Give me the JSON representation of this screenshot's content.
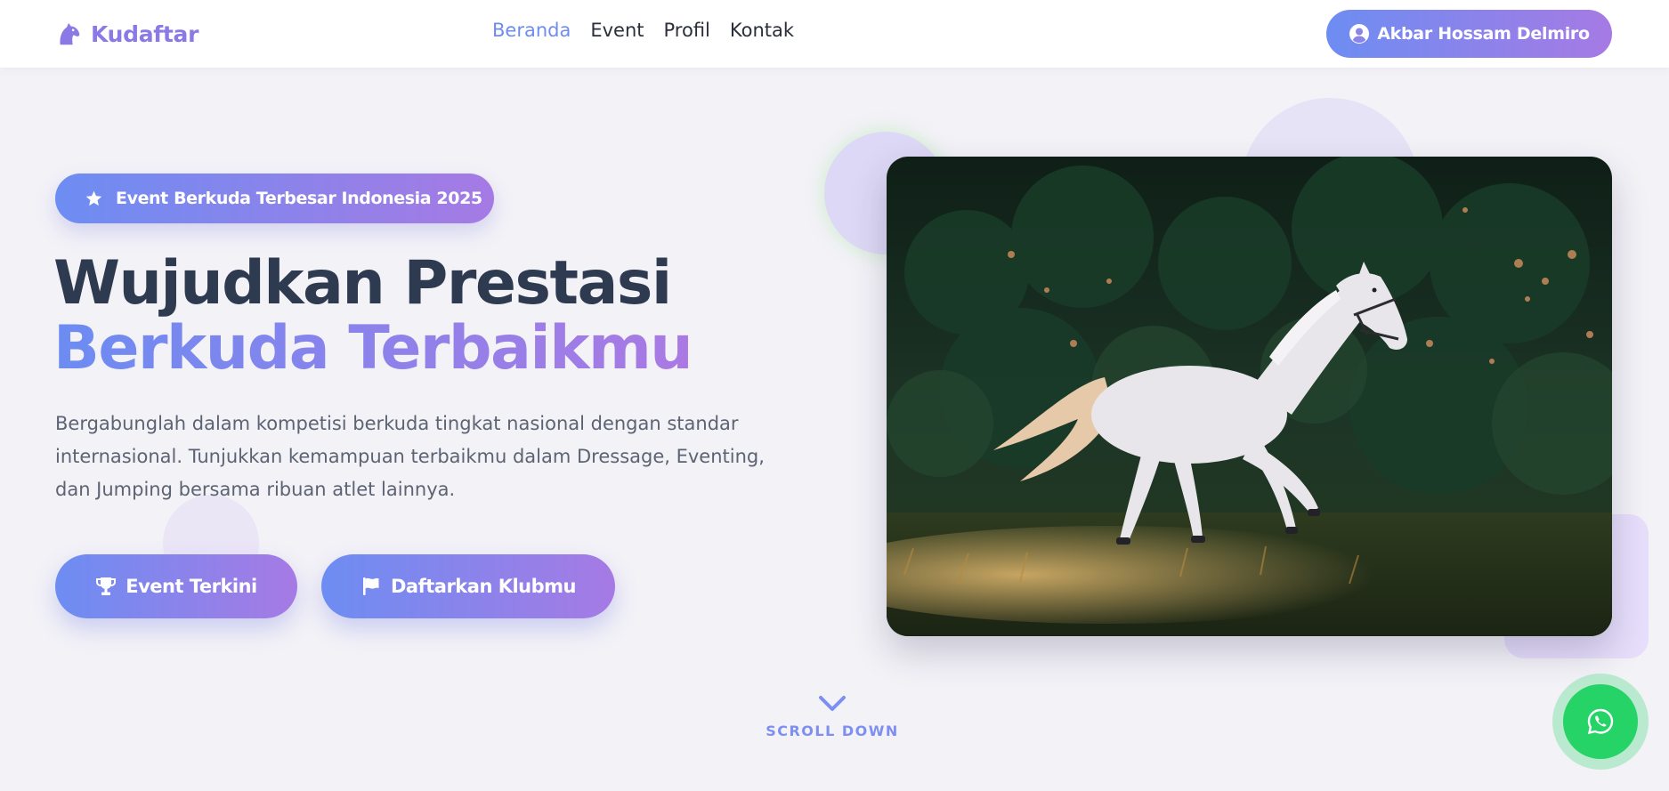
{
  "nav": {
    "brand": "Kudaftar",
    "links": [
      {
        "label": "Beranda",
        "active": true
      },
      {
        "label": "Event",
        "active": false
      },
      {
        "label": "Profil",
        "active": false
      },
      {
        "label": "Kontak",
        "active": false
      }
    ],
    "user_name": "Akbar Hossam Delmiro"
  },
  "hero": {
    "badge": "Event Berkuda Terbesar Indonesia 2025",
    "headline_line1": "Wujudkan Prestasi",
    "headline_line2": "Berkuda Terbaikmu",
    "description": "Bergabunglah dalam kompetisi berkuda tingkat nasional dengan standar internasional. Tunjukkan kemampuan terbaikmu dalam Dressage, Eventing, dan Jumping bersama ribuan atlet lainnya.",
    "primary_button": "Event Terkini",
    "secondary_button": "Daftarkan Klubmu",
    "scroll_label": "SCROLL DOWN"
  },
  "icons": {
    "brand": "horse-head-icon",
    "user": "user-circle-icon",
    "badge": "star-icon",
    "primary_button": "trophy-icon",
    "secondary_button": "flag-icon",
    "scroll": "chevron-down-icon",
    "floating": "whatsapp-icon"
  },
  "colors": {
    "accent_start": "#6d8df2",
    "accent_end": "#a67ae4",
    "active_link": "#6f8cf0",
    "heading": "#2d3a4f",
    "whatsapp": "#25d366",
    "background": "#f3f2f7"
  }
}
